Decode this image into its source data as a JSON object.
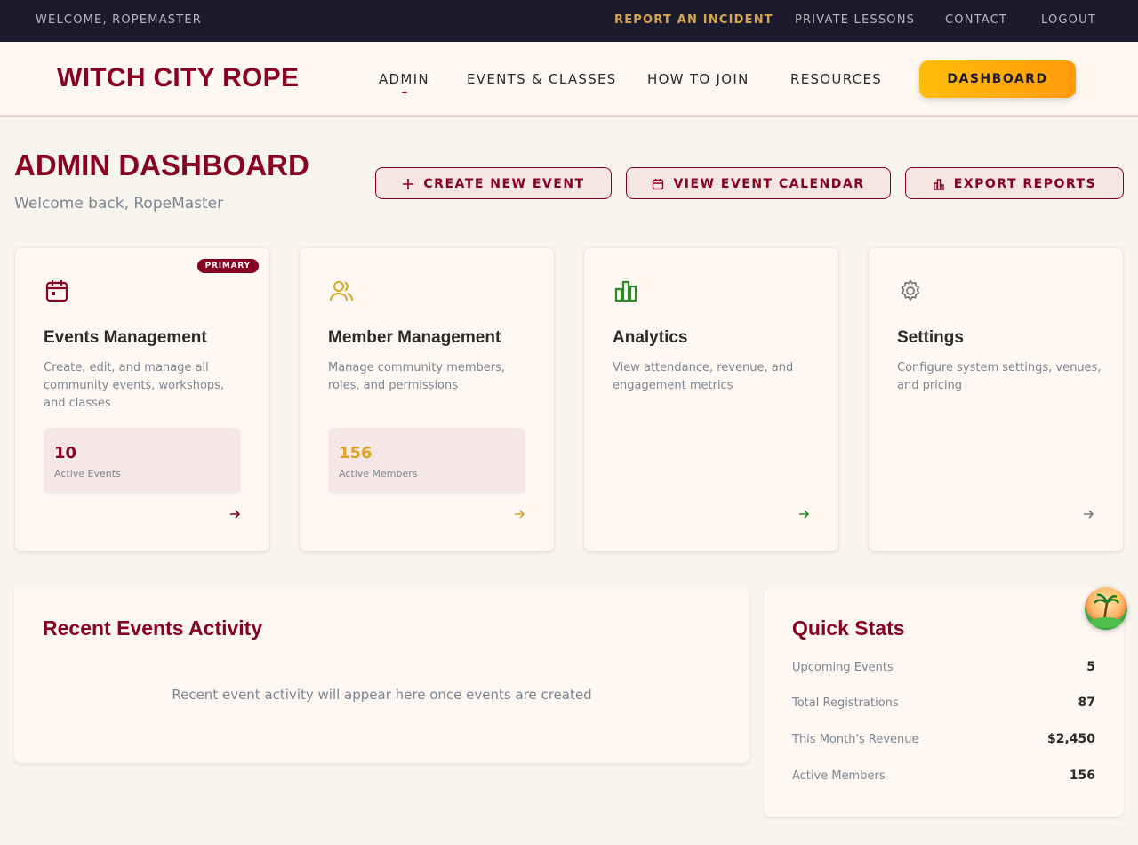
{
  "topbar": {
    "welcome": "WELCOME, ROPEMASTER",
    "links": [
      "REPORT AN INCIDENT",
      "PRIVATE LESSONS",
      "CONTACT",
      "LOGOUT"
    ]
  },
  "header": {
    "logo": "WITCH CITY ROPE",
    "nav": [
      "ADMIN",
      "EVENTS & CLASSES",
      "HOW TO JOIN",
      "RESOURCES"
    ],
    "dashboard_button": "DASHBOARD"
  },
  "page": {
    "title": "ADMIN DASHBOARD",
    "subtitle": "Welcome back, RopeMaster",
    "actions": [
      "CREATE NEW EVENT",
      "VIEW EVENT CALENDAR",
      "EXPORT REPORTS"
    ]
  },
  "cards": [
    {
      "badge": "PRIMARY",
      "title": "Events Management",
      "description": "Create, edit, and manage all community events, workshops, and classes",
      "stat_value": "10",
      "stat_label": "Active Events",
      "icon": "calendar-icon",
      "color": "#880124"
    },
    {
      "title": "Member Management",
      "description": "Manage community members, roles, and permissions",
      "stat_value": "156",
      "stat_label": "Active Members",
      "icon": "users-icon",
      "color": "#d9a528"
    },
    {
      "title": "Analytics",
      "description": "View attendance, revenue, and engagement metrics",
      "icon": "bar-chart-icon",
      "color": "#2a8a2a"
    },
    {
      "title": "Settings",
      "description": "Configure system settings, venues, and pricing",
      "icon": "gear-icon",
      "color": "#7a7a7a"
    }
  ],
  "recent": {
    "title": "Recent Events Activity",
    "empty_text": "Recent event activity will appear here once events are created"
  },
  "quick_stats": {
    "title": "Quick Stats",
    "rows": [
      {
        "label": "Upcoming Events",
        "value": "5"
      },
      {
        "label": "Total Registrations",
        "value": "87"
      },
      {
        "label": "This Month's Revenue",
        "value": "$2,450"
      },
      {
        "label": "Active Members",
        "value": "156"
      }
    ]
  }
}
